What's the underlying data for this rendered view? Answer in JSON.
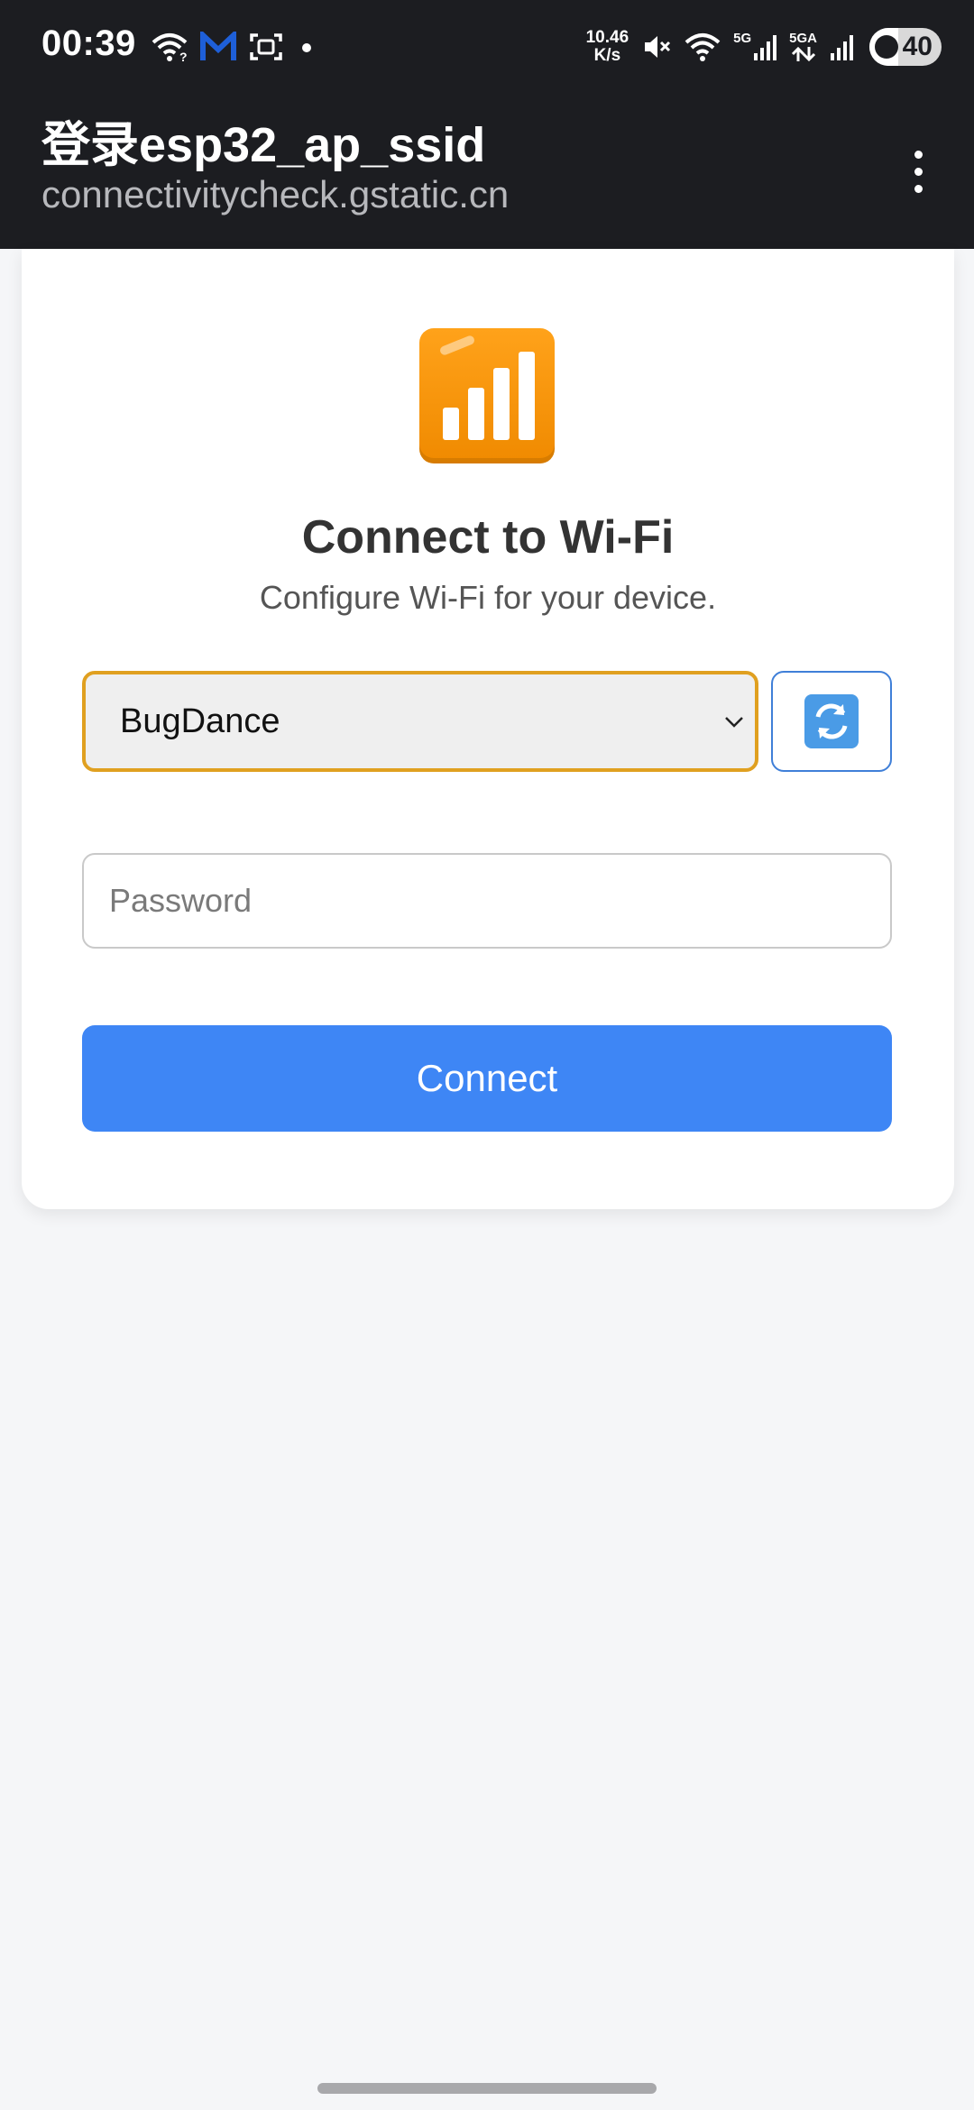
{
  "status_bar": {
    "time": "00:39",
    "left_icons": [
      "wifi-question-icon",
      "m-app-icon",
      "screenshot-icon",
      "dot-icon"
    ],
    "net_speed_value": "10.46",
    "net_speed_unit": "K/s",
    "signal_1_label": "5G",
    "signal_2_label": "5GA",
    "battery_level": "40"
  },
  "app_bar": {
    "title": "登录esp32_ap_ssid",
    "url": "connectivitycheck.gstatic.cn",
    "menu_icon": "more-vert-icon"
  },
  "card": {
    "icon": "signal-bars-icon",
    "icon_color": "#f59510",
    "title": "Connect to Wi-Fi",
    "subtitle": "Configure Wi-Fi for your device.",
    "network_select": {
      "selected": "BugDance"
    },
    "refresh_icon": "refresh-icon",
    "password_placeholder": "Password",
    "connect_label": "Connect"
  },
  "colors": {
    "accent": "#3e86f5",
    "select_border": "#e0a020",
    "bar_background": "#1c1d21"
  }
}
